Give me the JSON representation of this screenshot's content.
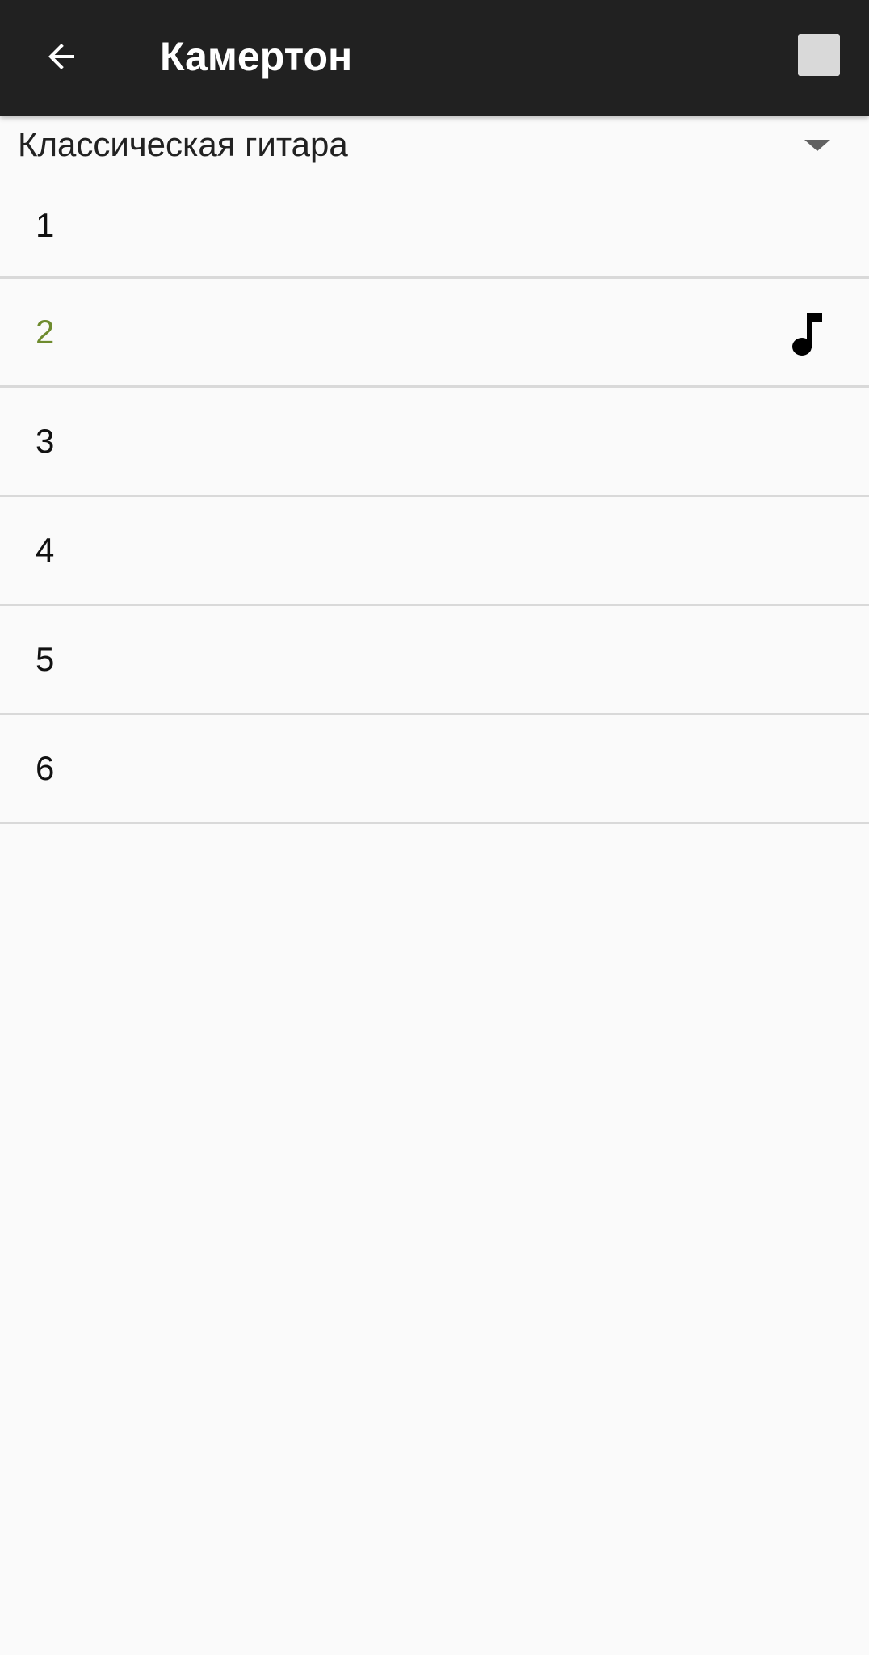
{
  "app_bar": {
    "title": "Камертон",
    "back_icon": "arrow-back-icon",
    "action_icon": "square-action-icon",
    "background_color": "#212121"
  },
  "tuning_selector": {
    "value": "Классическая гитара",
    "icon": "dropdown-arrow-icon"
  },
  "strings": [
    {
      "label": "1",
      "active": false
    },
    {
      "label": "2",
      "active": true,
      "icon": "music-note-icon"
    },
    {
      "label": "3",
      "active": false
    },
    {
      "label": "4",
      "active": false
    },
    {
      "label": "5",
      "active": false
    },
    {
      "label": "6",
      "active": false
    }
  ],
  "colors": {
    "active_string": "#6e8b2e",
    "divider": "#d9d9d9",
    "background": "#fafafa"
  }
}
